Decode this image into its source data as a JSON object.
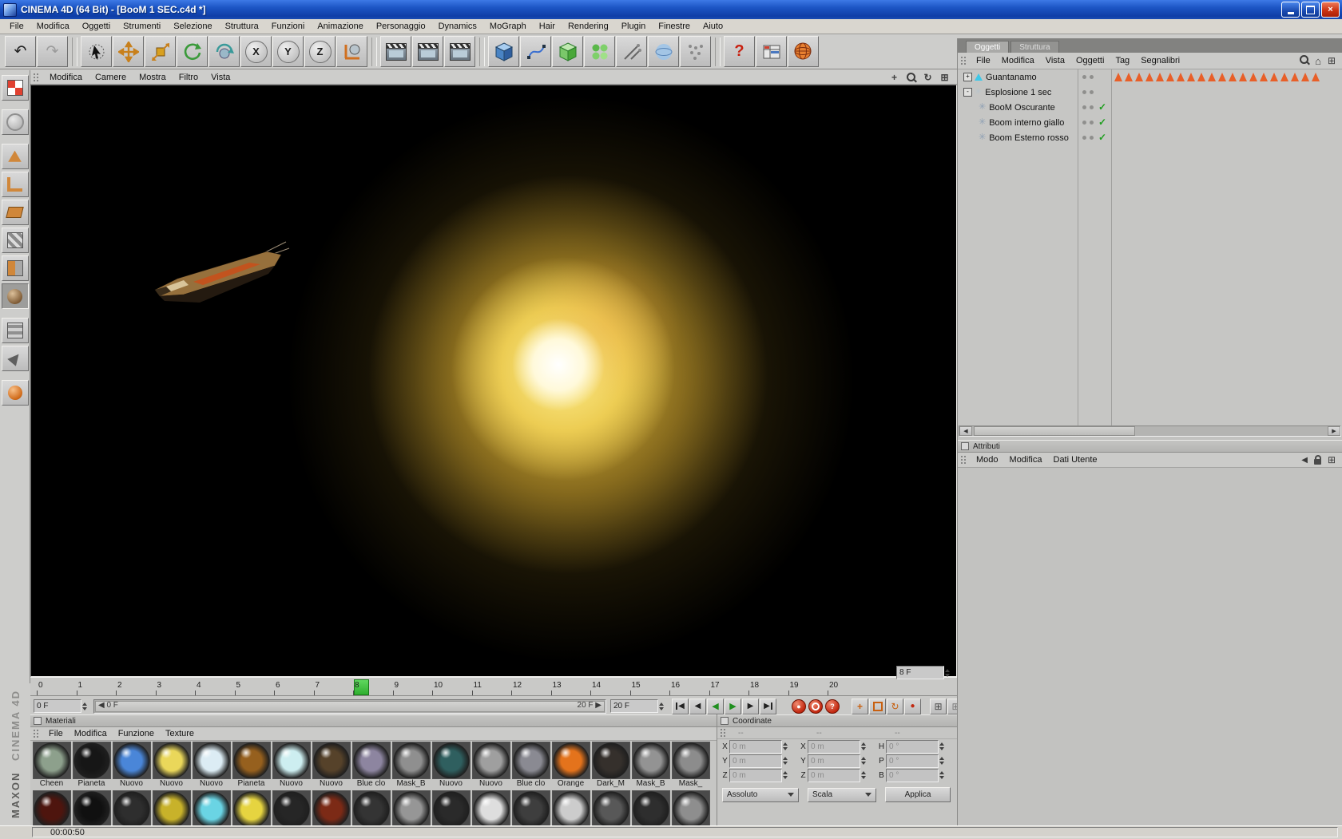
{
  "window": {
    "title": "CINEMA 4D (64 Bit) - [BooM 1 SEC.c4d *]"
  },
  "menubar": {
    "items": [
      "File",
      "Modifica",
      "Oggetti",
      "Strumenti",
      "Selezione",
      "Struttura",
      "Funzioni",
      "Animazione",
      "Personaggio",
      "Dynamics",
      "MoGraph",
      "Hair",
      "Rendering",
      "Plugin",
      "Finestre",
      "Aiuto"
    ]
  },
  "toolbar": {
    "axis": [
      "X",
      "Y",
      "Z"
    ],
    "help": "?"
  },
  "icons": {
    "undo": "↶",
    "redo": "↷",
    "rew": "◀",
    "play": "▶",
    "record": "●",
    "grid": "⊞",
    "home": "⌂",
    "check": "✓",
    "star": "✳",
    "rotate": "↻",
    "pan": "+",
    "question": "?"
  },
  "viewport": {
    "menu": [
      "Modifica",
      "Camere",
      "Mostra",
      "Filtro",
      "Vista"
    ]
  },
  "timeline": {
    "frames": [
      {
        "n": "0"
      },
      {
        "n": "1"
      },
      {
        "n": "2"
      },
      {
        "n": "3"
      },
      {
        "n": "4"
      },
      {
        "n": "5"
      },
      {
        "n": "6"
      },
      {
        "n": "7"
      },
      {
        "n": "8",
        "current": "true"
      },
      {
        "n": "9"
      },
      {
        "n": "10"
      },
      {
        "n": "11"
      },
      {
        "n": "12"
      },
      {
        "n": "13"
      },
      {
        "n": "14"
      },
      {
        "n": "15"
      },
      {
        "n": "16"
      },
      {
        "n": "17"
      },
      {
        "n": "18"
      },
      {
        "n": "19"
      },
      {
        "n": "20"
      }
    ],
    "current_frame": 8,
    "frame_display": "8 F",
    "start_value": "0 F",
    "end_value": "20 F",
    "range_start_label": "0 F",
    "range_end_label": "20 F"
  },
  "objects_panel": {
    "tabs": [
      {
        "label": "Oggetti",
        "active": true
      },
      {
        "label": "Struttura",
        "active": false
      }
    ],
    "menu": [
      "File",
      "Modifica",
      "Vista",
      "Oggetti",
      "Tag",
      "Segnalibri"
    ],
    "items": [
      {
        "label": "Guantanamo",
        "expander": "+",
        "level": 0
      },
      {
        "label": "Esplosione 1 sec",
        "expander": "-",
        "level": 0
      },
      {
        "label": "BooM Oscurante",
        "level": 1,
        "enabled": true
      },
      {
        "label": "Boom interno giallo",
        "level": 1,
        "enabled": true
      },
      {
        "label": "Boom Esterno rosso",
        "level": 1,
        "enabled": true
      }
    ],
    "tag_count": 20,
    "tag_color": "#e85f28"
  },
  "attributes_panel": {
    "title": "Attributi",
    "menu": [
      "Modo",
      "Modifica",
      "Dati Utente"
    ]
  },
  "materials_panel": {
    "title": "Materiali",
    "menu": [
      "File",
      "Modifica",
      "Funzione",
      "Texture"
    ],
    "items": [
      {
        "name": "Cheen",
        "color": "#8da08c"
      },
      {
        "name": "Pianeta",
        "color": "#161616"
      },
      {
        "name": "Nuovo",
        "color": "#4a86d8"
      },
      {
        "name": "Nuovo",
        "color": "#ead75a"
      },
      {
        "name": "Nuovo",
        "color": "#dcecf4"
      },
      {
        "name": "Pianeta",
        "color": "#96601e"
      },
      {
        "name": "Nuovo",
        "color": "#cdeef0"
      },
      {
        "name": "Nuovo",
        "color": "#56422a"
      },
      {
        "name": "Blue clo",
        "color": "#8d85a0"
      },
      {
        "name": "Mask_B",
        "color": "#8f8f8f"
      },
      {
        "name": "Nuovo",
        "color": "#2f5f5f"
      },
      {
        "name": "Nuovo",
        "color": "#9f9f9f"
      },
      {
        "name": "Blue clo",
        "color": "#8a8a92"
      },
      {
        "name": "Orange",
        "color": "#e4731c"
      },
      {
        "name": "Dark_M",
        "color": "#35302c"
      },
      {
        "name": "Mask_B",
        "color": "#939393"
      },
      {
        "name": "Mask_",
        "color": "#8c8c8c"
      }
    ],
    "row2_colors": [
      "#4e150e",
      "#101010",
      "#2e2e2e",
      "#c8b22a",
      "#6ad4e4",
      "#e6d440",
      "#262626",
      "#7c2a16",
      "#343434",
      "#969696",
      "#2a2a2a",
      "#dedede",
      "#3e3e3e",
      "#cccccc",
      "#585858",
      "#2e2e2e",
      "#8e8e8e"
    ]
  },
  "coordinates_panel": {
    "title": "Coordinate",
    "column_headers": [
      "--",
      "--",
      "--"
    ],
    "rows": [
      {
        "pl": "X",
        "pv": "0 m",
        "sl": "X",
        "sv": "0 m",
        "rl": "H",
        "rv": "0 °"
      },
      {
        "pl": "Y",
        "pv": "0 m",
        "sl": "Y",
        "sv": "0 m",
        "rl": "P",
        "rv": "0 °"
      },
      {
        "pl": "Z",
        "pv": "0 m",
        "sl": "Z",
        "sv": "0 m",
        "rl": "B",
        "rv": "0 °"
      }
    ],
    "mode_dropdown": "Assoluto",
    "scale_dropdown": "Scala",
    "apply_button": "Applica"
  },
  "statusbar": {
    "time": "00:00:50"
  },
  "branding": {
    "maxon": "MAXON",
    "cinema": "CINEMA 4D"
  }
}
